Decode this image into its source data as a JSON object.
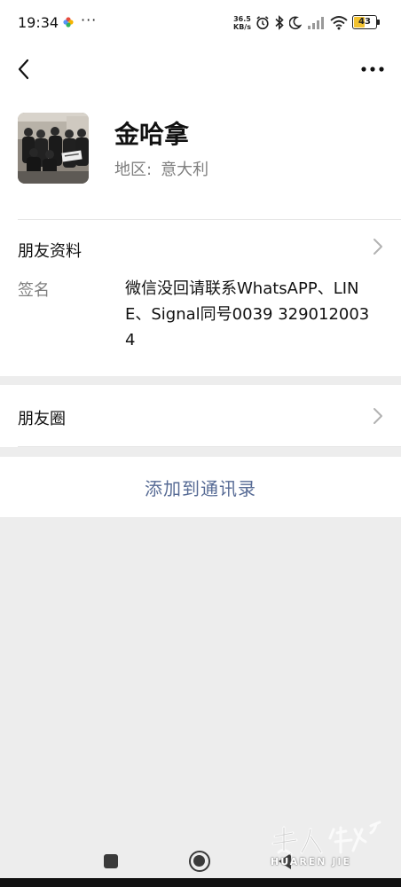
{
  "status_bar": {
    "time": "19:34",
    "more": "···",
    "net_speed_value": "36.5",
    "net_speed_unit": "KB/s",
    "battery_level": "43",
    "icons": [
      "photos-icon",
      "alarm-icon",
      "bluetooth-icon",
      "moon-icon",
      "signal-icon",
      "wifi-icon",
      "battery-icon"
    ]
  },
  "header": {
    "back_icon": "chevron-left-icon",
    "more_icon": "more-dots-icon"
  },
  "profile": {
    "name": "金哈拿",
    "region_label": "地区:",
    "region_value": "意大利"
  },
  "friend_info": {
    "title": "朋友资料",
    "signature_label": "签名",
    "signature_value": "微信没回请联系WhatsAPP、LINE、Signal同号0039 3290120034"
  },
  "moments": {
    "title": "朋友圈"
  },
  "actions": {
    "add_to_contacts": "添加到通讯录"
  },
  "colors": {
    "link_blue": "#576b95",
    "page_bg": "#ededed",
    "battery_yellow": "#f2c230"
  }
}
